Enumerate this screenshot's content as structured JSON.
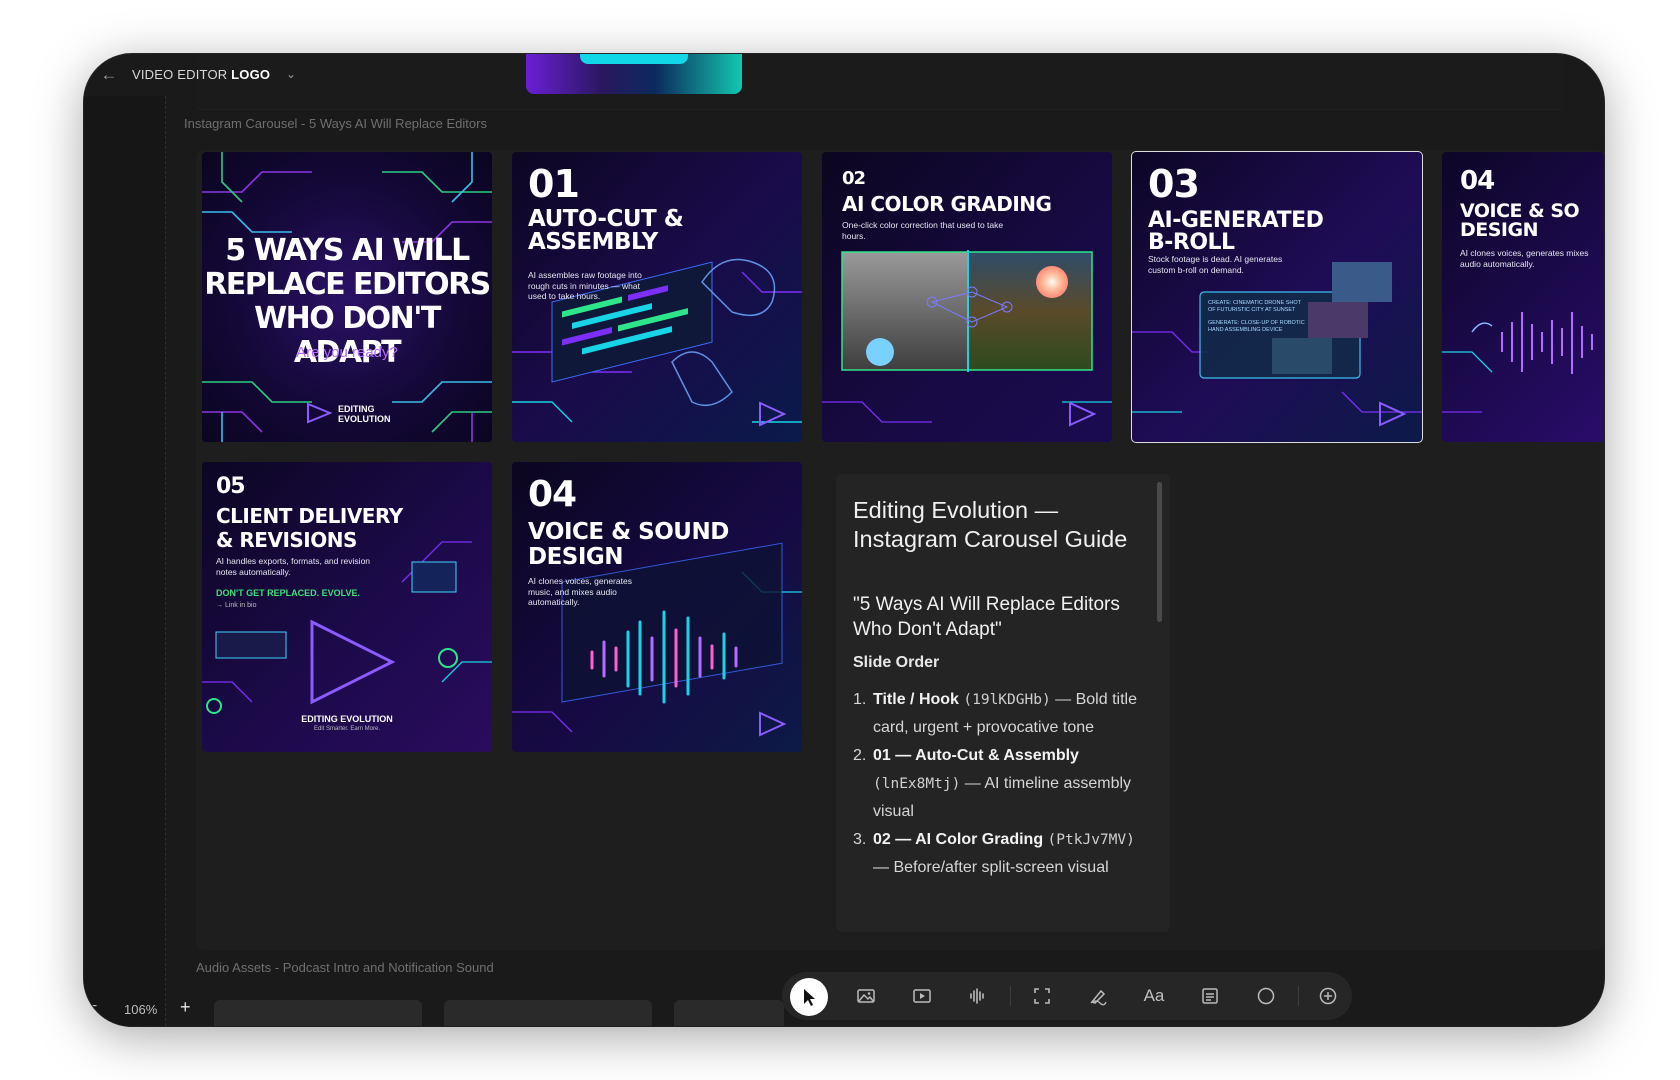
{
  "app": {
    "logo_prefix": "VIDEO EDITOR",
    "logo_bold": "LOGO"
  },
  "sections": {
    "carousel_label": "Instagram Carousel - 5 Ways AI Will Replace Editors",
    "audio_label": "Audio Assets - Podcast Intro and Notification Sound"
  },
  "slides": {
    "title": {
      "line1": "5 WAYS AI WILL",
      "line2": "REPLACE EDITORS",
      "line3": "WHO DON'T ADAPT",
      "cta": "Are you ready?",
      "brand1": "EDITING",
      "brand2": "EVOLUTION"
    },
    "s01": {
      "num": "01",
      "head1": "AUTO-CUT &",
      "head2": "ASSEMBLY",
      "sub": "AI assembles raw footage into rough cuts in minutes — what used to take hours."
    },
    "s02": {
      "num": "02",
      "head": "AI COLOR GRADING",
      "sub": "One-click color correction that used to take hours."
    },
    "s03": {
      "num": "03",
      "head1": "AI-GENERATED",
      "head2": "B-ROLL",
      "sub": "Stock footage is dead. AI generates custom b-roll on demand.",
      "panel1": "CREATE: CINEMATIC DRONE SHOT OF FUTURISTIC CITY AT SUNSET",
      "panel2": "GENERATE: CLOSE-UP OF ROBOTIC HAND ASSEMBLING DEVICE"
    },
    "s04a": {
      "num": "04",
      "head1": "VOICE & SO",
      "head2": "DESIGN",
      "sub": "AI clones voices, generates mixes audio automatically."
    },
    "s05": {
      "num": "05",
      "head1": "CLIENT DELIVERY",
      "head2": "& REVISIONS",
      "sub": "AI handles exports, formats, and revision notes automatically.",
      "cta": "DON'T GET REPLACED. EVOLVE.",
      "link": "→ Link in bio",
      "brand": "EDITING EVOLUTION",
      "tag": "Edit Smarter. Earn More."
    },
    "s04": {
      "num": "04",
      "head1": "VOICE & SOUND",
      "head2": "DESIGN",
      "sub": "AI clones voices, generates music, and mixes audio automatically."
    }
  },
  "guide": {
    "title": "Editing Evolution — Instagram Carousel Guide",
    "subtitle": "\"5 Ways AI Will Replace Editors Who Don't Adapt\"",
    "section": "Slide Order",
    "items": [
      {
        "num": "1.",
        "bold": "Title / Hook",
        "code": "(19lKDGHb)",
        "rest": " — Bold title card, urgent + provocative tone"
      },
      {
        "num": "2.",
        "bold": "01 — Auto-Cut & Assembly",
        "code": "(lnEx8Mtj)",
        "rest": " — AI timeline assembly visual"
      },
      {
        "num": "3.",
        "bold": "02 — AI Color Grading",
        "code": "(PtkJv7MV)",
        "rest": " — Before/after split-screen visual"
      }
    ]
  },
  "zoom": {
    "minus": "−",
    "value": "106%",
    "plus": "+"
  },
  "toolbar": {
    "items": [
      "pointer-tool",
      "image-tool",
      "video-tool",
      "audio-tool",
      "frame-tool",
      "pen-tool",
      "text-tool",
      "note-tool",
      "shape-tool",
      "add-tool"
    ],
    "text_tool_label": "Aa"
  },
  "colors": {
    "accent_purple": "#7b2ff7",
    "accent_cyan": "#19d3e6",
    "accent_green": "#2ee58a",
    "cta_green": "#3ee07a"
  }
}
